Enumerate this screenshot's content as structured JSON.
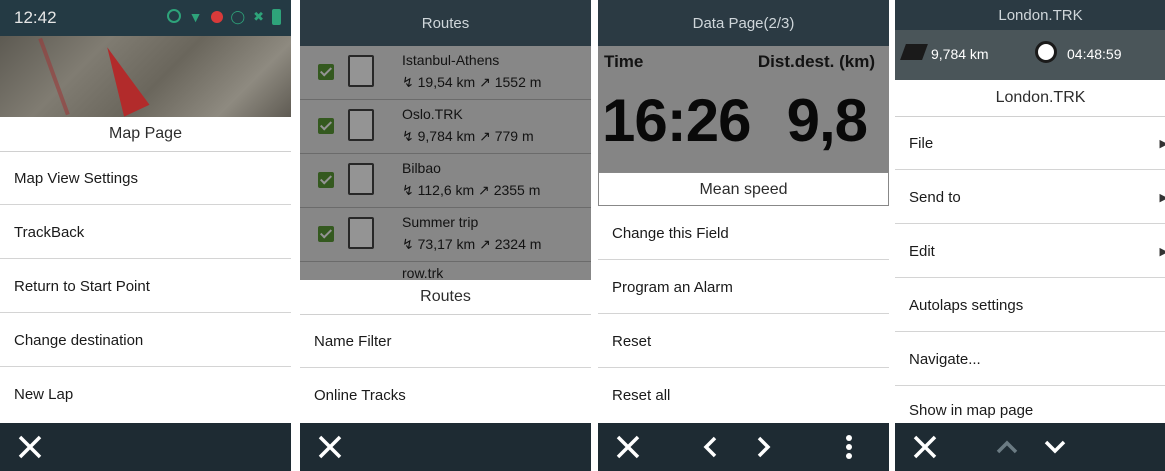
{
  "colors": {
    "header": "#2b3a43",
    "footer": "#1e2b33",
    "check": "#5a9a36"
  },
  "panel1": {
    "status_time": "12:42",
    "menu_title": "Map Page",
    "items": [
      "Map View Settings",
      "TrackBack",
      "Return to Start Point",
      "Change destination",
      "New Lap"
    ],
    "close_icon": "close-icon"
  },
  "panel2": {
    "header": "Routes",
    "routes": [
      {
        "name": "Istanbul-Athens",
        "info": "19,54 km",
        "elev": "1552 m"
      },
      {
        "name": "Oslo.TRK",
        "info": "9,784 km",
        "elev": "779 m"
      },
      {
        "name": "Bilbao",
        "info": "112,6 km",
        "elev": "2355 m"
      },
      {
        "name": "Summer trip",
        "info": "73,17 km",
        "elev": "2324 m"
      },
      {
        "name": "row.trk",
        "info": "",
        "elev": ""
      }
    ],
    "menu_title": "Routes",
    "items": [
      "Name Filter",
      "Online Tracks"
    ]
  },
  "panel3": {
    "header": "Data Page(2/3)",
    "label_left": "Time",
    "label_right": "Dist.dest. (km)",
    "value_left": "16:26",
    "value_right": "9,8",
    "menu_title": "Mean speed",
    "items": [
      "Change this Field",
      "Program an Alarm",
      "Reset",
      "Reset all"
    ]
  },
  "panel4": {
    "header": "London.TRK",
    "distance": "9,784 km",
    "duration": "04:48:59",
    "menu_title": "London.TRK",
    "items": [
      {
        "label": "File",
        "submenu": true
      },
      {
        "label": "Send to",
        "submenu": true
      },
      {
        "label": "Edit",
        "submenu": true
      },
      {
        "label": "Autolaps settings",
        "submenu": false
      },
      {
        "label": "Navigate...",
        "submenu": false
      },
      {
        "label": "Show in map page",
        "submenu": false
      }
    ]
  }
}
